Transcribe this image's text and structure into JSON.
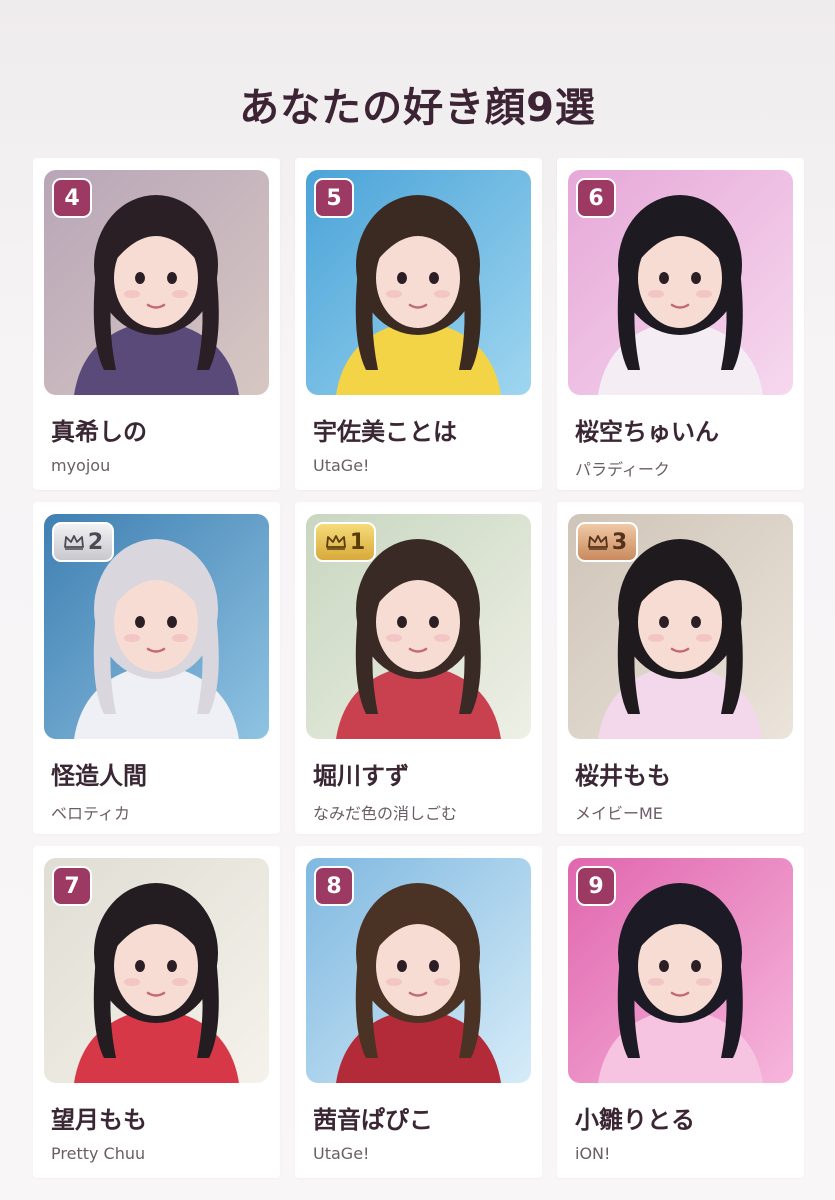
{
  "title": "あなたの好き顔9選",
  "cards": [
    {
      "badge": "4",
      "rank_type": "number",
      "name": "真希しの",
      "group": "myojou",
      "colors": {
        "bg1": "#b8a6b8",
        "bg2": "#d7c7c2",
        "hair": "#2a1f24",
        "cloth": "#5a4a7a"
      }
    },
    {
      "badge": "5",
      "rank_type": "number",
      "name": "宇佐美ことは",
      "group": "UtaGe!",
      "colors": {
        "bg1": "#4aa3d8",
        "bg2": "#9fd6f0",
        "hair": "#3a2a22",
        "cloth": "#f3d447"
      }
    },
    {
      "badge": "6",
      "rank_type": "number",
      "name": "桜空ちゅいん",
      "group": "パラディーク",
      "colors": {
        "bg1": "#e6a8d8",
        "bg2": "#f6d8ee",
        "hair": "#1e1a22",
        "cloth": "#f4eef4"
      }
    },
    {
      "badge": "2",
      "rank_type": "silver",
      "name": "怪造人間",
      "group": "ベロティカ",
      "colors": {
        "bg1": "#3f7fb2",
        "bg2": "#8fc3e2",
        "hair": "#d9d6de",
        "cloth": "#eef0f6"
      }
    },
    {
      "badge": "1",
      "rank_type": "gold",
      "name": "堀川すず",
      "group": "なみだ色の消しごむ",
      "colors": {
        "bg1": "#c8d6c0",
        "bg2": "#eef0e6",
        "hair": "#3a2a26",
        "cloth": "#c9404f"
      }
    },
    {
      "badge": "3",
      "rank_type": "bronze",
      "name": "桜井もも",
      "group": "メイビーME",
      "colors": {
        "bg1": "#cfc4b8",
        "bg2": "#ebe4da",
        "hair": "#1f1a1e",
        "cloth": "#f3d8ec"
      }
    },
    {
      "badge": "7",
      "rank_type": "number",
      "name": "望月もも",
      "group": "Pretty Chuu",
      "colors": {
        "bg1": "#e0ddd4",
        "bg2": "#f4f2ea",
        "hair": "#231c20",
        "cloth": "#d63848"
      }
    },
    {
      "badge": "8",
      "rank_type": "number",
      "name": "茜音ぱぴこ",
      "group": "UtaGe!",
      "colors": {
        "bg1": "#7fb8e0",
        "bg2": "#d6ecf8",
        "hair": "#4a3224",
        "cloth": "#b32a38"
      }
    },
    {
      "badge": "9",
      "rank_type": "number",
      "name": "小雛りとる",
      "group": "iON!",
      "colors": {
        "bg1": "#e066ae",
        "bg2": "#f6b6dc",
        "hair": "#1c1a24",
        "cloth": "#f6c4e0"
      }
    }
  ],
  "colors": {
    "accent": "#9c3a63",
    "title": "#3d2435",
    "background": "#f6f4f5",
    "card": "#ffffff"
  },
  "icons": {
    "crown": "crown-icon"
  }
}
